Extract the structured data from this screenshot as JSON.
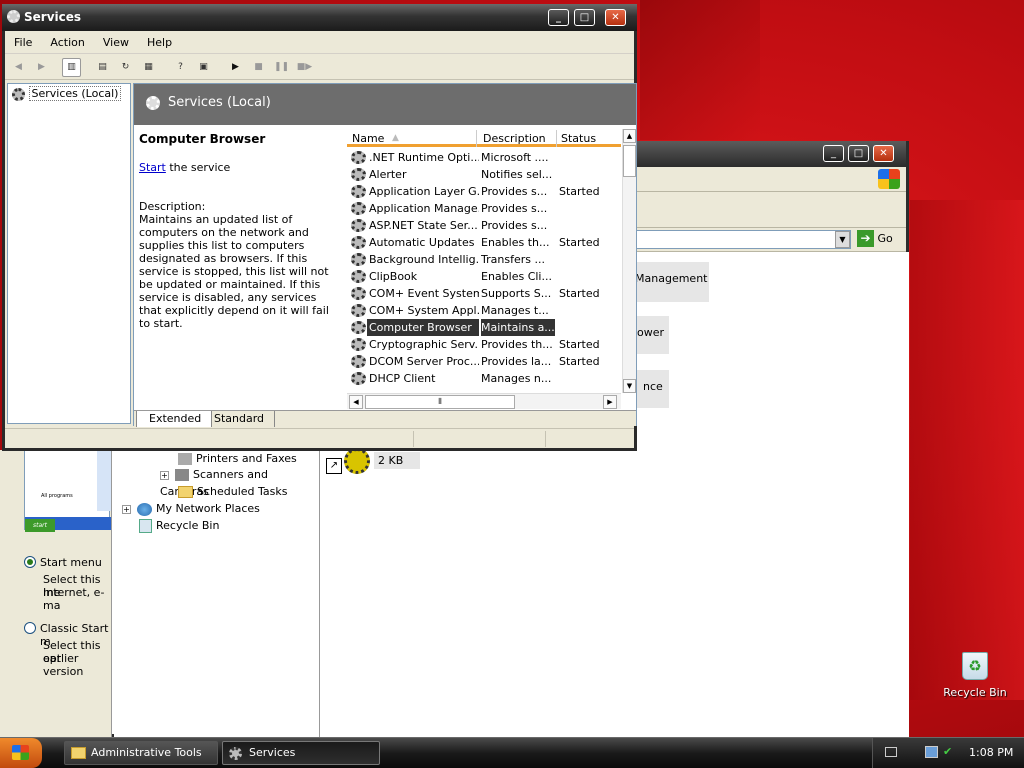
{
  "services_window": {
    "title": "Services",
    "menu": [
      "File",
      "Action",
      "View",
      "Help"
    ],
    "tree_item": "Services (Local)",
    "detail_header": "Services (Local)",
    "selected_service": "Computer Browser",
    "start_link": "Start",
    "start_suffix": " the service",
    "description_label": "Description:",
    "description": "Maintains an updated list of computers on the network and supplies this list to computers designated as browsers. If this service is stopped, this list will not be updated or maintained. If this service is disabled, any services that explicitly depend on it will fail to start.",
    "columns": [
      "Name",
      "Description",
      "Status"
    ],
    "rows": [
      {
        "name": ".NET Runtime Opti...",
        "description": "Microsoft ....",
        "status": ""
      },
      {
        "name": "Alerter",
        "description": "Notifies sel...",
        "status": ""
      },
      {
        "name": "Application Layer G...",
        "description": "Provides s...",
        "status": "Started"
      },
      {
        "name": "Application Manage...",
        "description": "Provides s...",
        "status": ""
      },
      {
        "name": "ASP.NET State Ser...",
        "description": "Provides s...",
        "status": ""
      },
      {
        "name": "Automatic Updates",
        "description": "Enables th...",
        "status": "Started"
      },
      {
        "name": "Background Intellig...",
        "description": "Transfers ...",
        "status": ""
      },
      {
        "name": "ClipBook",
        "description": "Enables Cli...",
        "status": ""
      },
      {
        "name": "COM+ Event System",
        "description": "Supports S...",
        "status": "Started"
      },
      {
        "name": "COM+ System Appl...",
        "description": "Manages t...",
        "status": ""
      },
      {
        "name": "Computer Browser",
        "description": "Maintains a...",
        "status": "",
        "selected": true
      },
      {
        "name": "Cryptographic Serv...",
        "description": "Provides th...",
        "status": "Started"
      },
      {
        "name": "DCOM Server Proc...",
        "description": "Provides la...",
        "status": "Started"
      },
      {
        "name": "DHCP Client",
        "description": "Manages n...",
        "status": ""
      }
    ],
    "tabs": [
      "Extended",
      "Standard"
    ]
  },
  "background_window": {
    "go_label": "Go",
    "frag_management": "r Management",
    "frag_ower": "ower",
    "frag_nce": "nce",
    "tree": [
      "Printers and Faxes",
      "Scanners and Cameras",
      "Scheduled Tasks",
      "My Network Places",
      "Recycle Bin"
    ],
    "file_size": "2 KB"
  },
  "left_dialog": {
    "preview_text": "All programs",
    "preview_start": "start",
    "start_menu_label": "Start menu",
    "start_menu_desc_1": "Select this me",
    "start_menu_desc_2": "Internet, e-ma",
    "classic_label": "Classic Start m",
    "classic_desc_1": "Select this opt",
    "classic_desc_2": "earlier version"
  },
  "desktop": {
    "recycle_bin": "Recycle Bin"
  },
  "taskbar": {
    "tasks": [
      "Administrative Tools",
      "Services"
    ],
    "clock": "1:08 PM"
  }
}
